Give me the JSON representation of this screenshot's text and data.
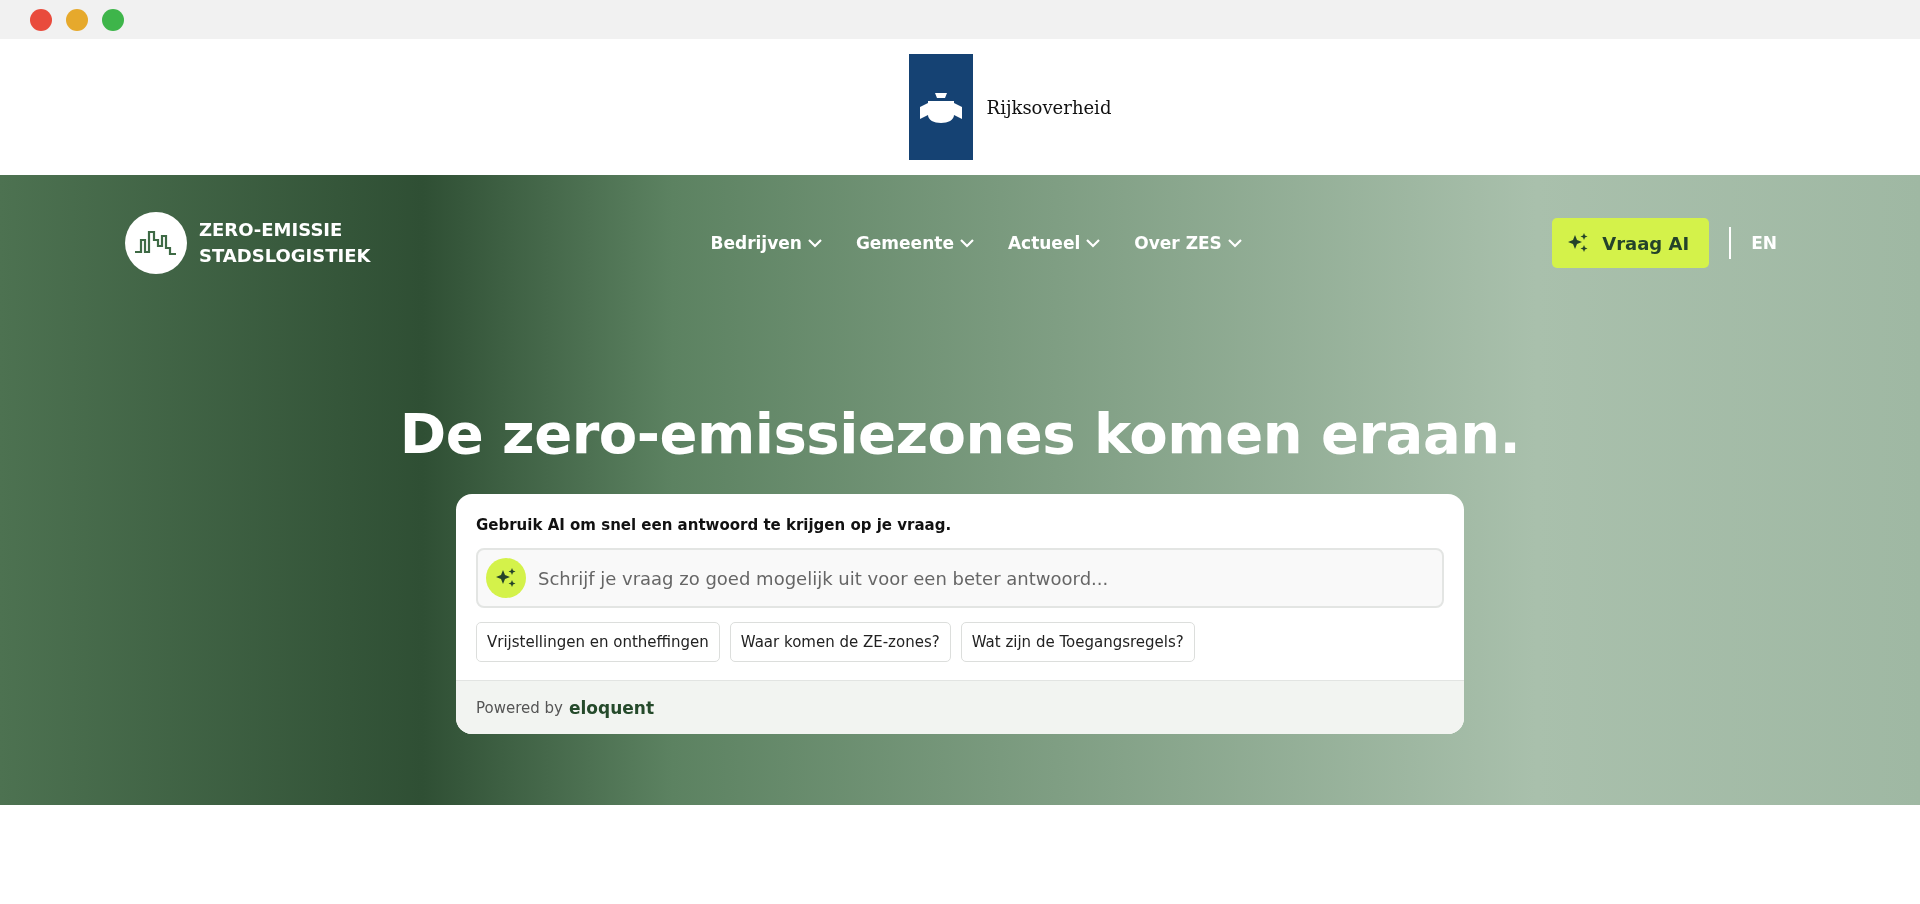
{
  "window": {
    "controls": [
      {
        "color": "#e94b3c"
      },
      {
        "color": "#e6a92c"
      },
      {
        "color": "#3eb54a"
      }
    ]
  },
  "gov_header": {
    "name": "Rijksoverheid"
  },
  "nav": {
    "logo_lines": [
      "ZERO-EMISSIE",
      "STADSLOGISTIEK"
    ],
    "items": [
      {
        "label": "Bedrijven"
      },
      {
        "label": "Gemeente"
      },
      {
        "label": "Actueel"
      },
      {
        "label": "Over ZES"
      }
    ],
    "ai_button": "Vraag AI",
    "language": "EN"
  },
  "hero": {
    "title": "De zero-emissiezones komen eraan."
  },
  "ai_card": {
    "intro": "Gebruik AI om snel een antwoord te krijgen op je vraag.",
    "placeholder": "Schrijf je vraag zo goed mogelijk uit voor een beter antwoord...",
    "suggestions": [
      "Vrijstellingen en ontheffingen",
      "Waar komen de ZE-zones?",
      "Wat zijn de Toegangsregels?"
    ],
    "powered_by": "Powered by",
    "brand": "eloquent"
  }
}
